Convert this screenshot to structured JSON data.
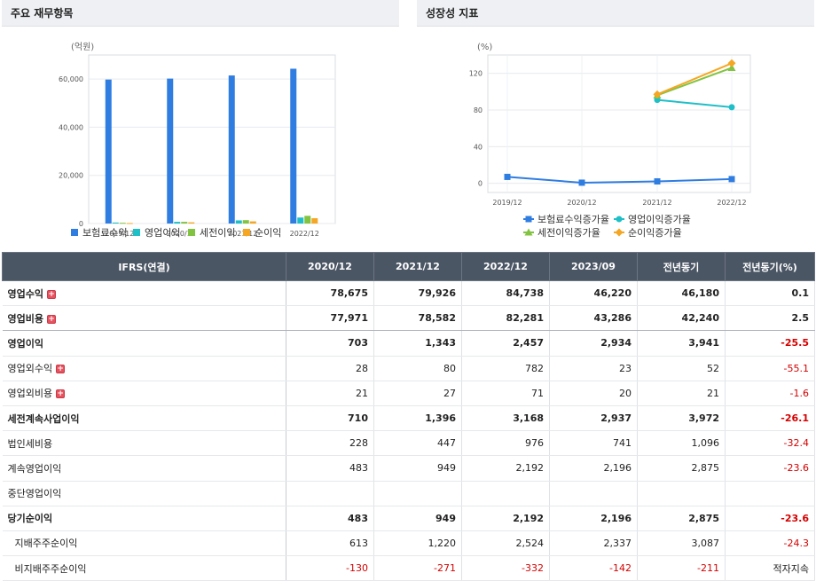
{
  "panels": {
    "left_title": "주요 재무항목",
    "right_title": "성장성 지표"
  },
  "chart_data": [
    {
      "type": "bar",
      "unit": "(억원)",
      "categories": [
        "2019/12",
        "2020/12",
        "2021/12",
        "2022/12"
      ],
      "ylim": [
        0,
        70000
      ],
      "ticks": [
        0,
        20000,
        40000,
        60000
      ],
      "tick_labels": [
        "0",
        "20,000",
        "40,000",
        "60,000"
      ],
      "series": [
        {
          "name": "보험료수익",
          "color": "#2f7de1",
          "values": [
            59800,
            60200,
            61500,
            64300
          ]
        },
        {
          "name": "영업이익",
          "color": "#1fbfc8",
          "values": [
            400,
            700,
            1300,
            2500
          ]
        },
        {
          "name": "세전이익",
          "color": "#82c341",
          "values": [
            300,
            700,
            1400,
            3200
          ]
        },
        {
          "name": "순이익",
          "color": "#f5a623",
          "values": [
            200,
            500,
            900,
            2200
          ]
        }
      ],
      "legend": "bottom"
    },
    {
      "type": "line",
      "unit": "(%)",
      "categories": [
        "2019/12",
        "2020/12",
        "2021/12",
        "2022/12"
      ],
      "ylim": [
        -10,
        140
      ],
      "ticks": [
        0,
        40,
        80,
        120
      ],
      "tick_labels": [
        "0",
        "40",
        "80",
        "120"
      ],
      "series": [
        {
          "name": "보험료수익증가율",
          "color": "#2f7de1",
          "marker": "square",
          "values": [
            7,
            0.7,
            2.1,
            4.6
          ]
        },
        {
          "name": "영업이익증가율",
          "color": "#1fbfc8",
          "marker": "circle",
          "values": [
            null,
            null,
            91,
            83
          ]
        },
        {
          "name": "세전이익증가율",
          "color": "#82c341",
          "marker": "triangle",
          "values": [
            null,
            null,
            96,
            126
          ]
        },
        {
          "name": "순이익증가율",
          "color": "#f5a623",
          "marker": "diamond",
          "values": [
            null,
            null,
            97,
            131
          ]
        }
      ],
      "legend": "bottom"
    }
  ],
  "table": {
    "header": [
      "IFRS(연결)",
      "2020/12",
      "2021/12",
      "2022/12",
      "2023/09",
      "전년동기",
      "전년동기(%)"
    ],
    "rows": [
      {
        "label": "영업수익",
        "bold": true,
        "plus": true,
        "line": false,
        "cells": [
          "78,675",
          "79,926",
          "84,738",
          "46,220",
          "46,180",
          "0.1"
        ]
      },
      {
        "label": "영업비용",
        "bold": true,
        "plus": true,
        "line": true,
        "cells": [
          "77,971",
          "78,582",
          "82,281",
          "43,286",
          "42,240",
          "2.5"
        ]
      },
      {
        "label": "영업이익",
        "bold": true,
        "plus": false,
        "line": false,
        "cells": [
          "703",
          "1,343",
          "2,457",
          "2,934",
          "3,941",
          "-25.5"
        ]
      },
      {
        "label": "영업외수익",
        "bold": false,
        "plus": true,
        "line": false,
        "cells": [
          "28",
          "80",
          "782",
          "23",
          "52",
          "-55.1"
        ]
      },
      {
        "label": "영업외비용",
        "bold": false,
        "plus": true,
        "line": false,
        "cells": [
          "21",
          "27",
          "71",
          "20",
          "21",
          "-1.6"
        ]
      },
      {
        "label": "세전계속사업이익",
        "bold": true,
        "plus": false,
        "line": false,
        "cells": [
          "710",
          "1,396",
          "3,168",
          "2,937",
          "3,972",
          "-26.1"
        ]
      },
      {
        "label": "법인세비용",
        "bold": false,
        "plus": false,
        "line": false,
        "cells": [
          "228",
          "447",
          "976",
          "741",
          "1,096",
          "-32.4"
        ]
      },
      {
        "label": "계속영업이익",
        "bold": false,
        "plus": false,
        "line": false,
        "cells": [
          "483",
          "949",
          "2,192",
          "2,196",
          "2,875",
          "-23.6"
        ]
      },
      {
        "label": "중단영업이익",
        "bold": false,
        "plus": false,
        "line": false,
        "cells": [
          "",
          "",
          "",
          "",
          "",
          ""
        ]
      },
      {
        "label": "당기순이익",
        "bold": true,
        "plus": false,
        "line": false,
        "cells": [
          "483",
          "949",
          "2,192",
          "2,196",
          "2,875",
          "-23.6"
        ]
      },
      {
        "label": "지배주주순이익",
        "bold": false,
        "plus": false,
        "line": false,
        "indent": true,
        "cells": [
          "613",
          "1,220",
          "2,524",
          "2,337",
          "3,087",
          "-24.3"
        ]
      },
      {
        "label": "비지배주주순이익",
        "bold": false,
        "plus": false,
        "line": false,
        "indent": true,
        "cells": [
          "-130",
          "-271",
          "-332",
          "-142",
          "-211",
          "적자지속"
        ]
      }
    ]
  }
}
